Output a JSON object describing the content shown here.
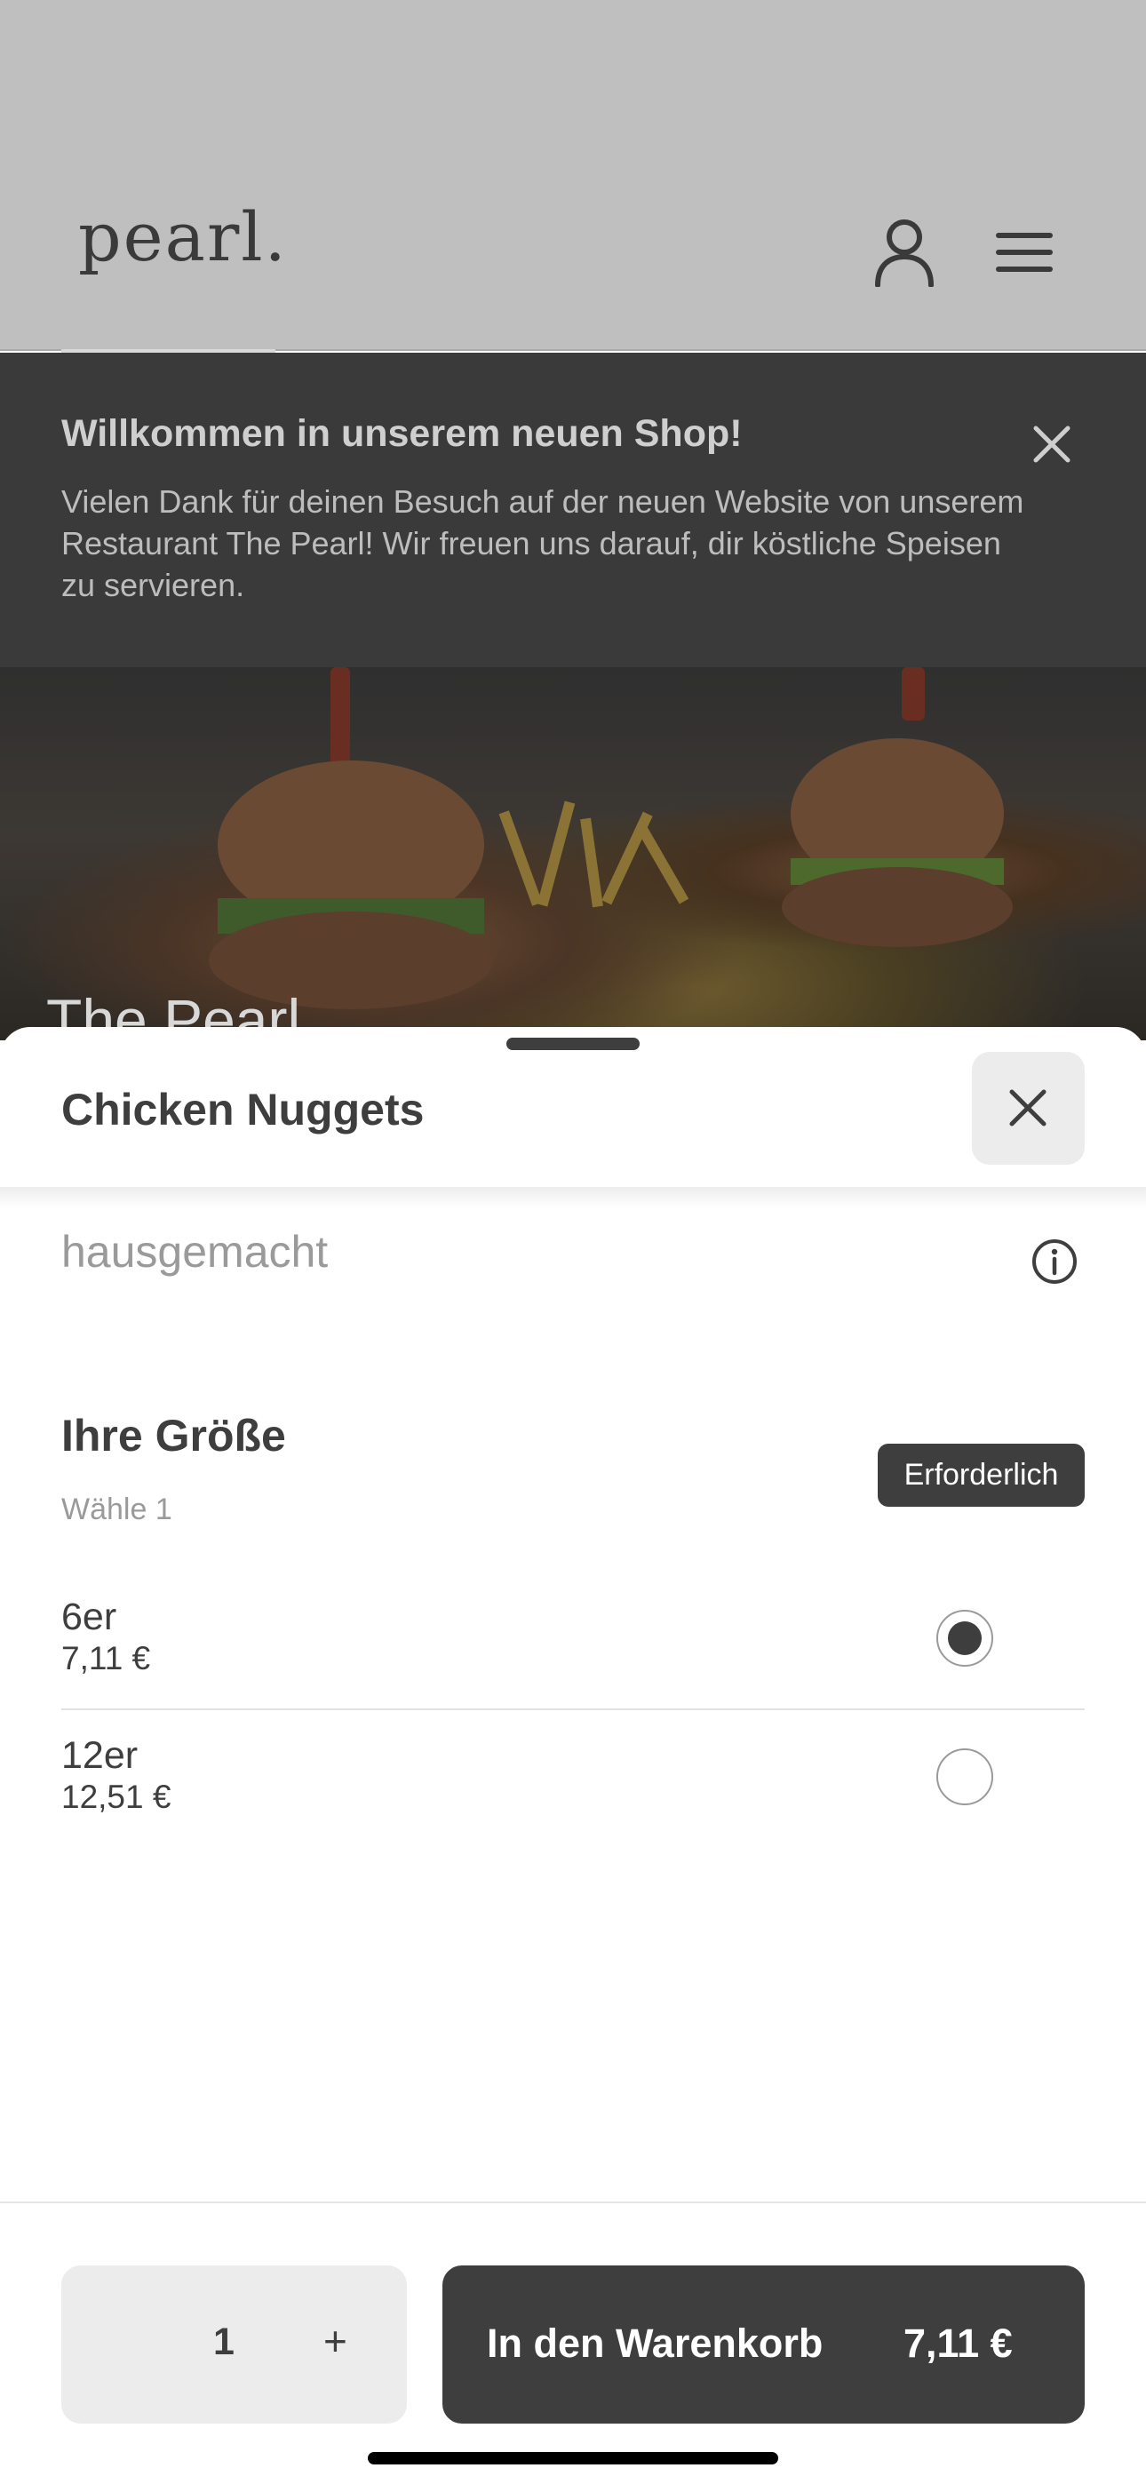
{
  "header": {
    "logo_text": "pearl.",
    "user_icon": "user-icon",
    "menu_icon": "hamburger-menu-icon"
  },
  "banner": {
    "title": "Willkommen in unserem neuen Shop!",
    "text": "Vielen Dank für deinen Besuch auf der neuen Website von unserem Restaurant The Pearl! Wir freuen uns darauf, dir köstliche Speisen zu servieren.",
    "close_icon": "close-icon"
  },
  "hero": {
    "title": "The Pearl"
  },
  "product_sheet": {
    "title": "Chicken Nuggets",
    "description": "hausgemacht",
    "info_icon": "info-icon",
    "option_group": {
      "title": "Ihre Größe",
      "subtitle": "Wähle 1",
      "badge": "Erforderlich",
      "options": [
        {
          "name": "6er",
          "price": "7,11 €",
          "selected": true
        },
        {
          "name": "12er",
          "price": "12,51 €",
          "selected": false
        }
      ]
    },
    "footer": {
      "quantity": "1",
      "plus_label": "+",
      "add_to_cart_label": "In den Warenkorb",
      "total": "7,11 €"
    }
  },
  "colors": {
    "primary_dark": "#3e3e3e",
    "muted_text": "#9a9a9a",
    "light_surface": "#ececec"
  }
}
